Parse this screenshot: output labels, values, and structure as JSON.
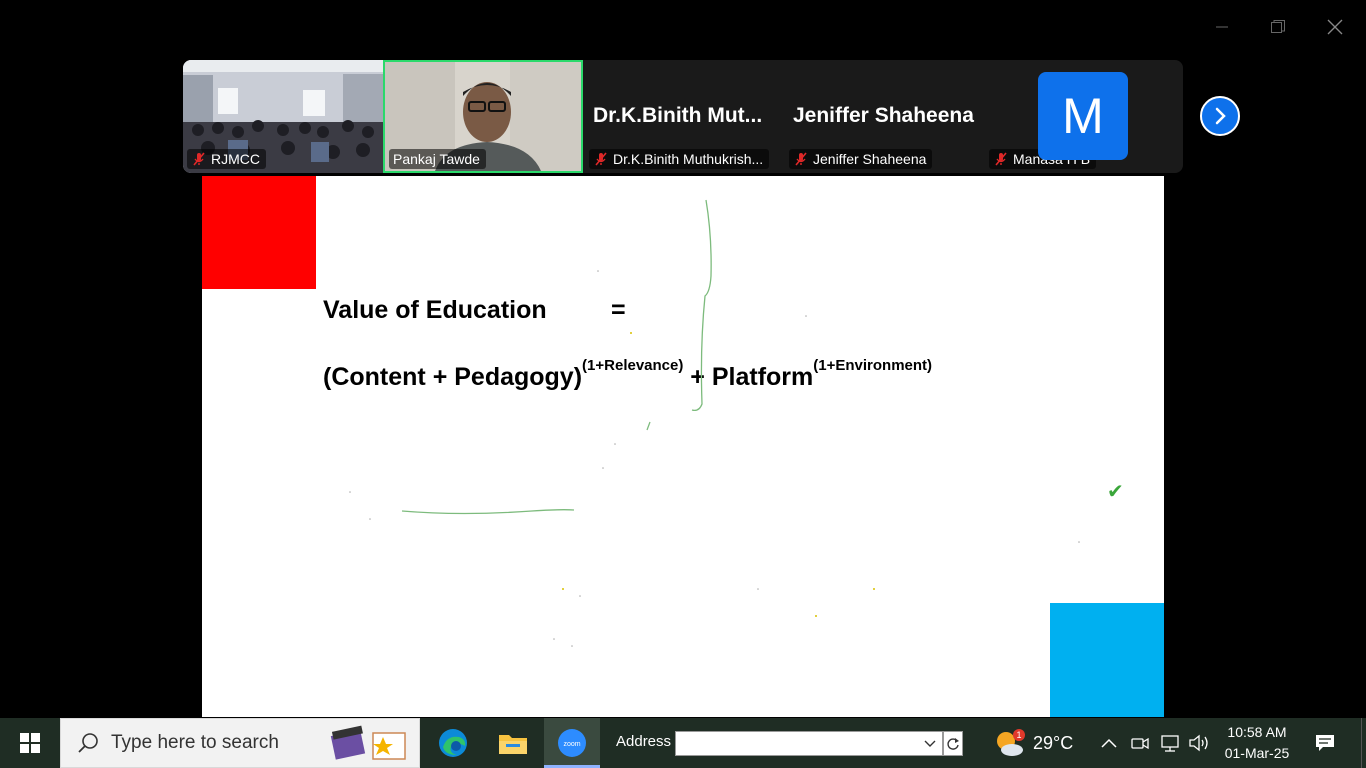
{
  "window": {
    "minimize_icon": "minimize-icon",
    "restore_icon": "restore-icon",
    "close_icon": "close-icon"
  },
  "participants": [
    {
      "name": "RJMCC",
      "muted": true,
      "type": "video"
    },
    {
      "name": "Pankaj Tawde",
      "muted": false,
      "type": "video",
      "speaking": true
    },
    {
      "name": "Dr.K.Binith Muthukrish...",
      "display_name": "Dr.K.Binith  Mut...",
      "muted": true,
      "type": "name"
    },
    {
      "name": "Jeniffer Shaheena",
      "display_name": "Jeniffer Shaheena",
      "muted": true,
      "type": "name"
    },
    {
      "name": "Manasa H B",
      "avatar_letter": "M",
      "muted": true,
      "type": "avatar"
    }
  ],
  "slide": {
    "line1": "Value of Education",
    "equals": "=",
    "expr_part1": "(Content + Pedagogy)",
    "expr_sup1": "(1+Relevance)",
    "expr_plus": " + Platform",
    "expr_sup2": "(1+Environment)",
    "checkmark": "✔"
  },
  "taskbar": {
    "search_placeholder": "Type here to search",
    "address_label": "Address",
    "weather_badge": "1",
    "temperature": "29°C",
    "time": "10:58 AM",
    "date": "01-Mar-25"
  },
  "colors": {
    "accent_blue": "#0e71eb",
    "speaker_border": "#2bd96b",
    "slide_red": "#ff0000",
    "slide_blue": "#00b0f0",
    "annotation_green": "#5cb85c",
    "taskbar_bg": "#1f2d24"
  }
}
